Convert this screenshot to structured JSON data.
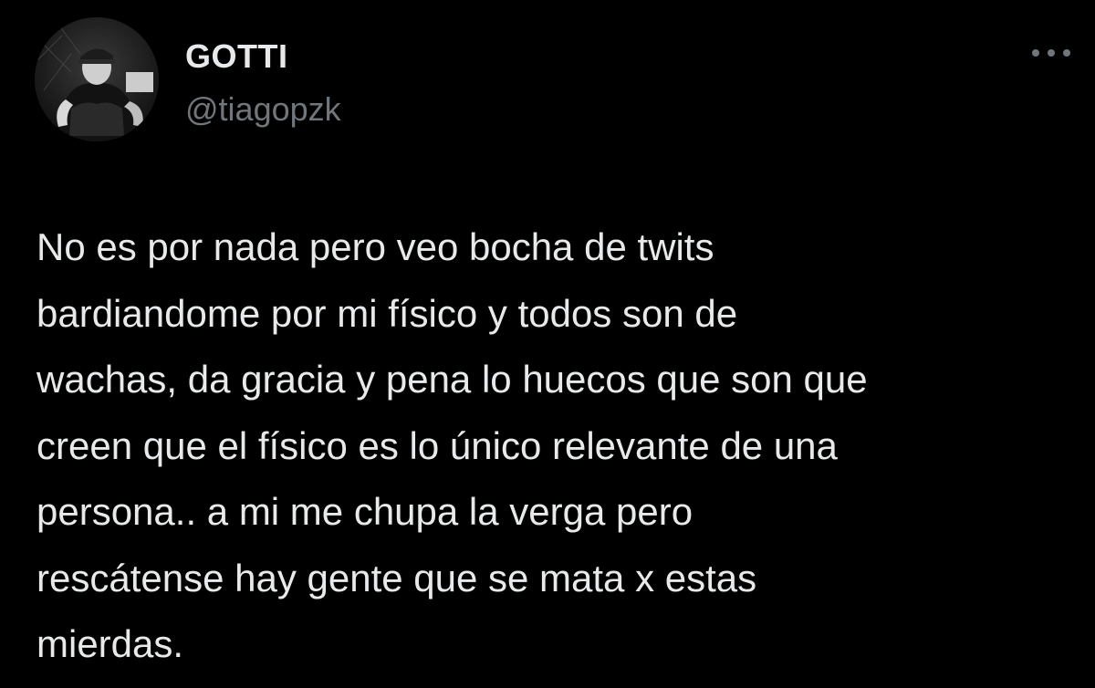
{
  "author": {
    "display_name": "GOTTI",
    "handle": "@tiagopzk"
  },
  "tweet": {
    "text": "No es por nada pero veo bocha de twits\nbardiandome por mi físico y todos son de\nwachas, da gracia y pena lo huecos que son que\ncreen que el físico es lo único relevante de una\npersona.. a mi me chupa la verga pero\nrescátense hay gente que se mata x estas\nmierdas."
  },
  "icons": {
    "more": "more-horizontal-icon"
  },
  "colors": {
    "background": "#000000",
    "text_primary": "#e7e9ea",
    "text_secondary": "#71767b"
  }
}
